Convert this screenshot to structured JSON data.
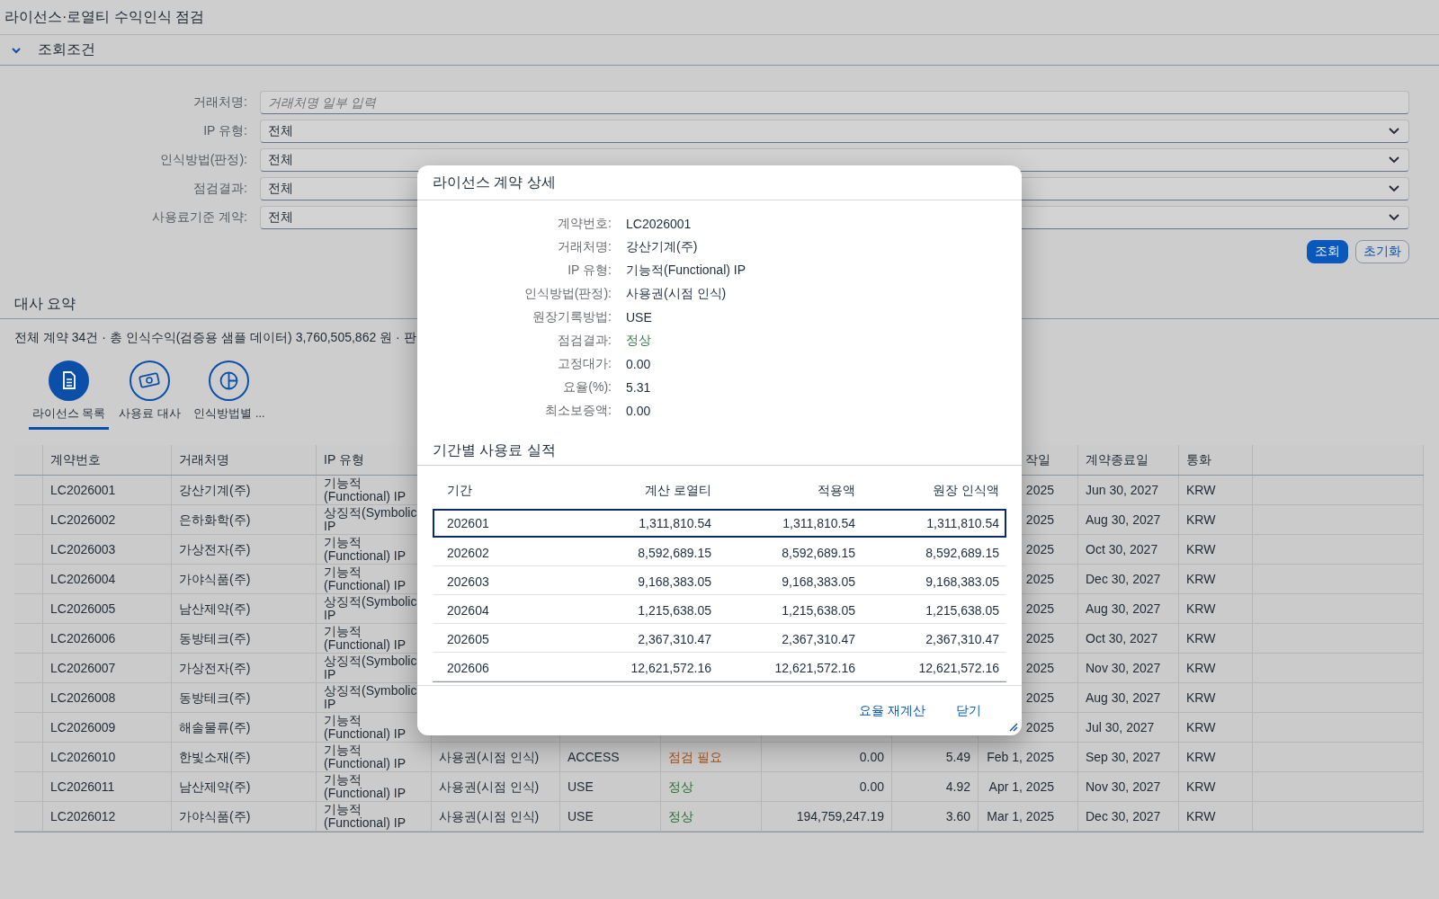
{
  "page_title": "라이선스·로열티 수익인식 점검",
  "filter_panel": {
    "title": "조회조건",
    "expanded": true,
    "filters": [
      {
        "kind": "input",
        "label": "거래처명:",
        "placeholder": "거래처명 일부 입력"
      },
      {
        "kind": "select",
        "label": "IP 유형:",
        "value": "전체"
      },
      {
        "kind": "select",
        "label": "인식방법(판정):",
        "value": "전체"
      },
      {
        "kind": "select",
        "label": "점검결과:",
        "value": "전체"
      },
      {
        "kind": "select",
        "label": "사용료기준 계약:",
        "value": "전체"
      }
    ],
    "buttons": [
      {
        "label": "조회",
        "kind": "primary"
      },
      {
        "label": "초기화",
        "kind": "secondary"
      }
    ]
  },
  "summary_panel": {
    "title": "대사 요약",
    "text": "전체 계약 34건 · 총 인식수익(검증용 샘플 데이터) 3,760,505,862 원 · 판"
  },
  "icon_tabs": [
    {
      "label": "라이선스 목록",
      "selected": true
    },
    {
      "label": "사용료 대사",
      "selected": false
    },
    {
      "label": "인식방법별 ...",
      "selected": false
    }
  ],
  "table": {
    "columns": [
      {
        "label": "계약번호"
      },
      {
        "label": "거래처명"
      },
      {
        "label": "IP 유형"
      },
      {},
      {},
      {},
      {},
      {},
      {
        "label": "작일"
      },
      {
        "label": "계약종료일"
      },
      {
        "label": "통화"
      }
    ],
    "rows": [
      {
        "cells": [
          "LC2026001",
          "강산기계(주)",
          "기능적\n(Functional) IP",
          null,
          null,
          null,
          null,
          null,
          "2025",
          "Jun 30, 2027",
          "KRW"
        ]
      },
      {
        "cells": [
          "LC2026002",
          "은하화학(주)",
          "상징적(Symbolic\nIP",
          null,
          null,
          null,
          null,
          null,
          "2025",
          "Aug 30, 2027",
          "KRW"
        ]
      },
      {
        "cells": [
          "LC2026003",
          "가상전자(주)",
          "기능적\n(Functional) IP",
          null,
          null,
          null,
          null,
          null,
          "2025",
          "Oct 30, 2027",
          "KRW"
        ]
      },
      {
        "cells": [
          "LC2026004",
          "가야식품(주)",
          "기능적\n(Functional) IP",
          null,
          null,
          null,
          null,
          null,
          "2025",
          "Dec 30, 2027",
          "KRW"
        ]
      },
      {
        "cells": [
          "LC2026005",
          "남산제약(주)",
          "상징적(Symbolic\nIP",
          null,
          null,
          null,
          null,
          null,
          "2025",
          "Aug 30, 2027",
          "KRW"
        ]
      },
      {
        "cells": [
          "LC2026006",
          "동방테크(주)",
          "기능적\n(Functional) IP",
          null,
          null,
          null,
          null,
          null,
          "2025",
          "Oct 30, 2027",
          "KRW"
        ]
      },
      {
        "cells": [
          "LC2026007",
          "가상전자(주)",
          "상징적(Symbolic\nIP",
          null,
          null,
          null,
          null,
          null,
          "2025",
          "Nov 30, 2027",
          "KRW"
        ]
      },
      {
        "cells": [
          "LC2026008",
          "동방테크(주)",
          "상징적(Symbolic\nIP",
          null,
          null,
          null,
          null,
          null,
          "2025",
          "Aug 30, 2027",
          "KRW"
        ]
      },
      {
        "cells": [
          "LC2026009",
          "해솔물류(주)",
          "기능적\n(Functional) IP",
          null,
          null,
          null,
          null,
          null,
          "2025",
          "Jul 30, 2027",
          "KRW"
        ]
      },
      {
        "cells": [
          "LC2026010",
          "한빛소재(주)",
          "기능적\n(Functional) IP",
          "사용권(시점 인식)",
          "ACCESS",
          {
            "text": "점검 필요",
            "color": "#a4501e"
          },
          "0.00",
          "5.49",
          "Feb 1, 2025",
          "Sep 30, 2027",
          "KRW"
        ]
      },
      {
        "cells": [
          "LC2026011",
          "남산제약(주)",
          "기능적\n(Functional) IP",
          "사용권(시점 인식)",
          "USE",
          {
            "text": "정상",
            "color": "#2f6e3a"
          },
          "0.00",
          "4.92",
          "Apr 1, 2025",
          "Nov 30, 2027",
          "KRW"
        ]
      },
      {
        "cells": [
          "LC2026012",
          "가야식품(주)",
          "기능적\n(Functional) IP",
          "사용권(시점 인식)",
          "USE",
          {
            "text": "정상",
            "color": "#2f6e3a"
          },
          "194,759,247.19",
          "3.60",
          "Mar 1, 2025",
          "Dec 30, 2027",
          "KRW"
        ]
      }
    ]
  },
  "dialog": {
    "title": "라이선스 계약 상세",
    "details": [
      {
        "label": "계약번호:",
        "value": "LC2026001"
      },
      {
        "label": "거래처명:",
        "value": "강산기계(주)"
      },
      {
        "label": "IP 유형:",
        "value": "기능적(Functional) IP"
      },
      {
        "label": "인식방법(판정):",
        "value": "사용권(시점 인식)"
      },
      {
        "label": "원장기록방법:",
        "value": "USE"
      },
      {
        "label": "점검결과:",
        "value": "정상",
        "color": "#2f7d3f"
      },
      {
        "label": "고정대가:",
        "value": "0.00"
      },
      {
        "label": "요율(%):",
        "value": "5.31"
      },
      {
        "label": "최소보증액:",
        "value": "0.00"
      }
    ],
    "section_title": "기간별 사용료 실적",
    "columns": [
      "기간",
      "계산 로열티",
      "적용액",
      "원장 인식액"
    ],
    "rows": [
      {
        "cells": [
          "202601",
          "1,311,810.54",
          "1,311,810.54",
          "1,311,810.54"
        ],
        "selected": true
      },
      {
        "cells": [
          "202602",
          "8,592,689.15",
          "8,592,689.15",
          "8,592,689.15"
        ],
        "selected": false
      },
      {
        "cells": [
          "202603",
          "9,168,383.05",
          "9,168,383.05",
          "9,168,383.05"
        ],
        "selected": false
      },
      {
        "cells": [
          "202604",
          "1,215,638.05",
          "1,215,638.05",
          "1,215,638.05"
        ],
        "selected": false
      },
      {
        "cells": [
          "202605",
          "2,367,310.47",
          "2,367,310.47",
          "2,367,310.47"
        ],
        "selected": false
      },
      {
        "cells": [
          "202606",
          "12,621,572.16",
          "12,621,572.16",
          "12,621,572.16"
        ],
        "selected": false
      }
    ],
    "buttons": [
      "요율 재계산",
      "닫기"
    ]
  }
}
